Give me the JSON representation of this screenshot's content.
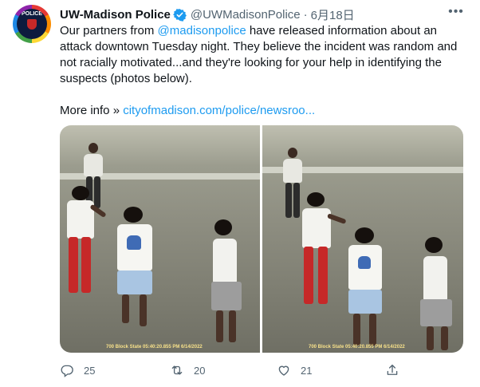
{
  "author": {
    "name": "UW-Madison Police",
    "handle": "@UWMadisonPolice",
    "separator": "·",
    "date": "6月18日",
    "avatar_text": "POLICE\nUNIVERSITY"
  },
  "more_icon": "•••",
  "tweet_text": {
    "before_mention": "Our partners from ",
    "mention": "@madisonpolice",
    "after_mention": " have released information about an attack downtown Tuesday night. They believe the incident was random and not racially motivated...and they're looking for your help in identifying the suspects (photos below).",
    "more_info_label": "More info » ",
    "link_text": "cityofmadison.com/police/newsroo..."
  },
  "media": {
    "left_stamp": "700 Block State 05:40:20.855 PM 6/14/2022",
    "right_stamp": "700 Block State 05:40:20.855 PM 6/14/2022"
  },
  "actions": {
    "reply_icon": "reply-icon",
    "reply_count": "25",
    "retweet_icon": "retweet-icon",
    "retweet_count": "20",
    "like_icon": "heart-icon",
    "like_count": "21",
    "share_icon": "share-icon"
  },
  "colors": {
    "link": "#1d9bf0",
    "verified": "#1d9bf0",
    "secondary_text": "#536471"
  }
}
